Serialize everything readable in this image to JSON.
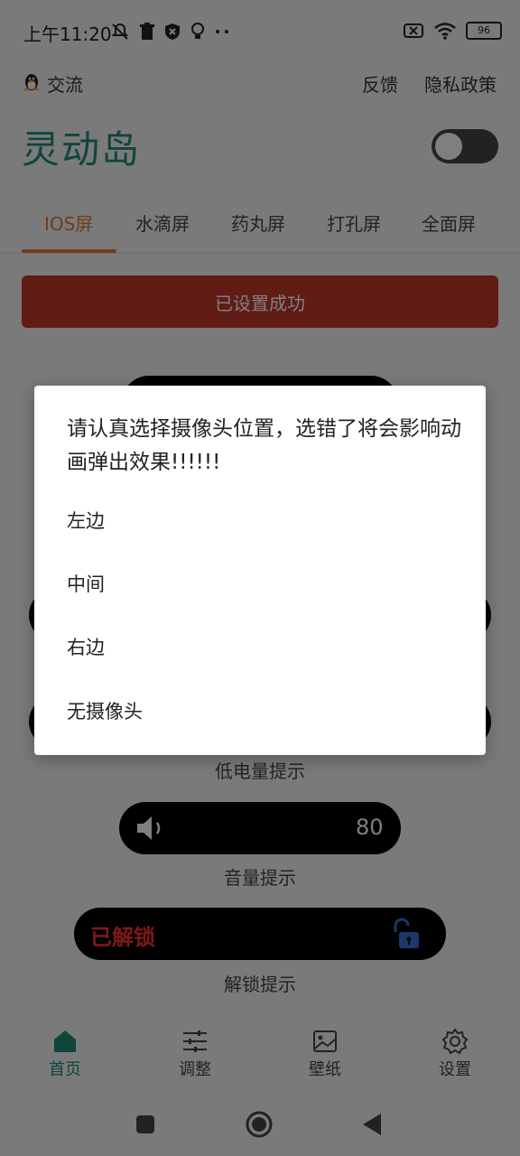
{
  "status_bar": {
    "time": "上午11:20",
    "icons_left": [
      "bell-off-icon",
      "trash-icon",
      "shield-icon",
      "bulb-icon",
      "more-dots-icon"
    ],
    "icons_right": [
      "sim-off-icon",
      "wifi-icon"
    ],
    "battery": "96"
  },
  "header": {
    "qq_label": "交流",
    "feedback": "反馈",
    "privacy": "隐私政策",
    "title": "灵动岛",
    "toggle_on": false
  },
  "tabs": [
    {
      "label": "IOS屏",
      "active": true
    },
    {
      "label": "水滴屏",
      "active": false
    },
    {
      "label": "药丸屏",
      "active": false
    },
    {
      "label": "打孔屏",
      "active": false
    },
    {
      "label": "全面屏",
      "active": false
    }
  ],
  "success_button": "已设置成功",
  "previews": {
    "low_battery_caption": "低电量提示",
    "volume_value": "80",
    "volume_caption": "音量提示",
    "unlock_text": "已解锁",
    "unlock_caption": "解锁提示"
  },
  "bottom_nav": [
    {
      "label": "首页",
      "icon": "home-icon",
      "active": true
    },
    {
      "label": "调整",
      "icon": "sliders-icon",
      "active": false
    },
    {
      "label": "壁纸",
      "icon": "image-icon",
      "active": false
    },
    {
      "label": "设置",
      "icon": "gear-icon",
      "active": false
    }
  ],
  "dialog": {
    "message": "请认真选择摄像头位置，选错了将会影响动画弹出效果!!!!!!",
    "options": [
      "左边",
      "中间",
      "右边",
      "无摄像头"
    ]
  },
  "colors": {
    "accent_teal": "#1f8a7a",
    "tab_active": "#e07a3a",
    "success_red": "#c0392b",
    "unlock_red": "#ff3030"
  }
}
